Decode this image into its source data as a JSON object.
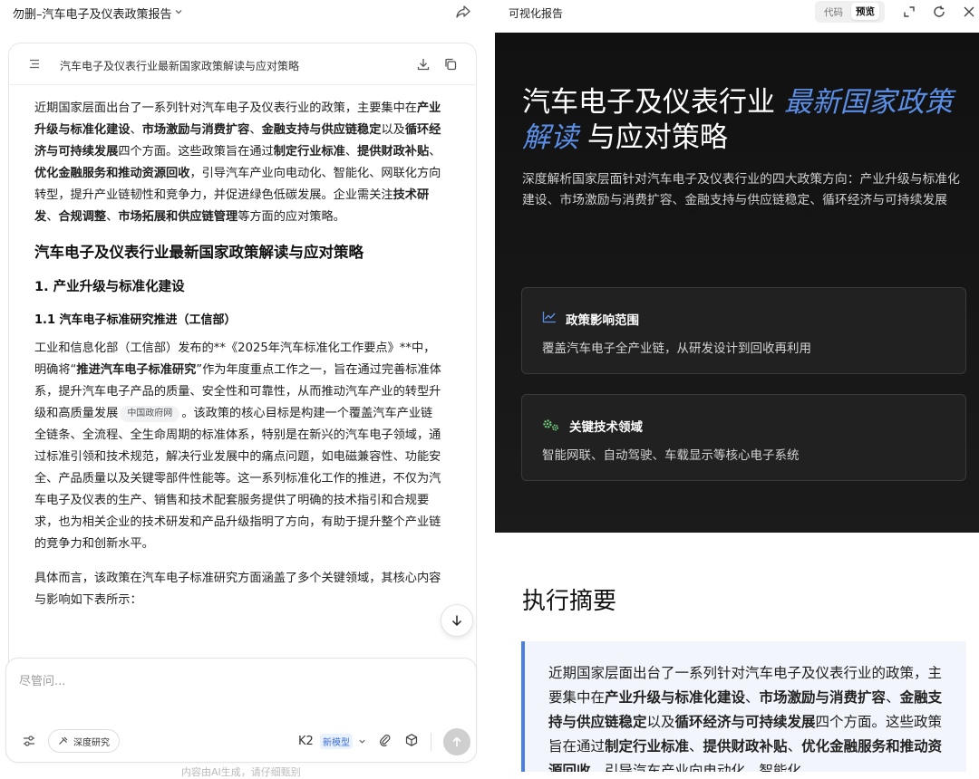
{
  "left": {
    "title": "勿删–汽车电子及仪表政策报告",
    "doc_card": {
      "title": "汽车电子及仪表行业最新国家政策解读与应对策略"
    },
    "doc": {
      "intro": [
        {
          "t": "近期国家层面出台了一系列针对汽车电子及仪表行业的政策，主要集中在",
          "b": false
        },
        {
          "t": "产业升级与标准化建设",
          "b": true
        },
        {
          "t": "、",
          "b": false
        },
        {
          "t": "市场激励与消费扩容",
          "b": true
        },
        {
          "t": "、",
          "b": false
        },
        {
          "t": "金融支持与供应链稳定",
          "b": true
        },
        {
          "t": "以及",
          "b": false
        },
        {
          "t": "循环经济与可持续发展",
          "b": true
        },
        {
          "t": "四个方面。这些政策旨在通过",
          "b": false
        },
        {
          "t": "制定行业标准",
          "b": true
        },
        {
          "t": "、",
          "b": false
        },
        {
          "t": "提供财政补贴",
          "b": true
        },
        {
          "t": "、",
          "b": false
        },
        {
          "t": "优化金融服务和推动资源回收",
          "b": true
        },
        {
          "t": "，引导汽车产业向电动化、智能化、网联化方向转型，提升产业链韧性和竞争力，并促进绿色低碳发展。企业需关注",
          "b": false
        },
        {
          "t": "技术研发",
          "b": true
        },
        {
          "t": "、",
          "b": false
        },
        {
          "t": "合规调整",
          "b": true
        },
        {
          "t": "、",
          "b": false
        },
        {
          "t": "市场拓展和供应链管理",
          "b": true
        },
        {
          "t": "等方面的应对策略。",
          "b": false
        }
      ],
      "h2": "汽车电子及仪表行业最新国家政策解读与应对策略",
      "h3": "1. 产业升级与标准化建设",
      "h4": "1.1 汽车电子标准研究推进（工信部）",
      "para2_a": "工业和信息化部（工信部）发布的**《2025年汽车标准化工作要点》**中，明确将“",
      "para2_bold": "推进汽车电子标准研究",
      "para2_b": "”作为年度重点工作之一，旨在通过完善标准体系，提升汽车电子产品的质量、安全性和可靠性，从而推动汽车产业的转型升级和高质量发展",
      "citation": "中国政府网",
      "para2_c": "。该政策的核心目标是构建一个覆盖汽车产业链全链条、全流程、全生命周期的标准体系，特别是在新兴的汽车电子领域，通过标准引领和技术规范，解决行业发展中的痛点问题，如电磁兼容性、功能安全、产品质量以及关键零部件性能等。这一系列标准化工作的推进，不仅为汽车电子及仪表的生产、销售和技术配套服务提供了明确的技术指引和合规要求，也为相关企业的技术研发和产品升级指明了方向，有助于提升整个产业链的竞争力和创新水平。",
      "para3": "具体而言，该政策在汽车电子标准研究方面涵盖了多个关键领域，其核心内容与影响如下表所示："
    },
    "composer": {
      "placeholder": "尽管问...",
      "deep_research": "深度研究",
      "model": "K2",
      "model_badge": "新模型"
    },
    "footer_note": "内容由AI生成，请仔细甄别"
  },
  "right": {
    "panel_title": "可视化报告",
    "tab_code": "代码",
    "tab_preview": "预览",
    "hero": {
      "title_a": "汽车电子及仪表行业 ",
      "title_accent": "最新国家政策解读",
      "title_b": " 与应对策略",
      "subtitle": "深度解析国家层面针对汽车电子及仪表行业的四大政策方向：产业升级与标准化建设、市场激励与消费扩容、金融支持与供应链稳定、循环经济与可持续发展"
    },
    "cards": {
      "scope_title": "政策影响范围",
      "scope_desc": "覆盖汽车电子全产业链，从研发设计到回收再利用",
      "tech_title": "关键技术领域",
      "tech_desc": "智能网联、自动驾驶、车载显示等核心电子系统"
    },
    "summary": {
      "heading": "执行摘要",
      "text": [
        {
          "t": "近期国家层面出台了一系列针对汽车电子及仪表行业的政策，主要集中在",
          "b": false
        },
        {
          "t": "产业升级与标准化建设",
          "b": true
        },
        {
          "t": "、",
          "b": false
        },
        {
          "t": "市场激励与消费扩容",
          "b": true
        },
        {
          "t": "、",
          "b": false
        },
        {
          "t": "金融支持与供应链稳定",
          "b": true
        },
        {
          "t": "以及",
          "b": false
        },
        {
          "t": "循环经济与可持续发展",
          "b": true
        },
        {
          "t": "四个方面。这些政策旨在通过",
          "b": false
        },
        {
          "t": "制定行业标准",
          "b": true
        },
        {
          "t": "、",
          "b": false
        },
        {
          "t": "提供财政补贴",
          "b": true
        },
        {
          "t": "、",
          "b": false
        },
        {
          "t": "优化金融服务和推动资源回收",
          "b": true
        },
        {
          "t": "，引导汽车产业向电动化、智能化",
          "b": false
        }
      ]
    }
  },
  "colors": {
    "accent": "#5b8ee6",
    "summary_border": "#4d7fe0",
    "badge": "#3b6ed6"
  },
  "icons": [
    "chevron-down-icon",
    "share-icon",
    "toc-icon",
    "download-icon",
    "copy-icon",
    "arrow-down-icon",
    "settings-icon",
    "telescope-icon",
    "paperclip-icon",
    "cube-icon",
    "send-arrow-icon",
    "expand-icon",
    "refresh-icon",
    "close-icon",
    "chart-line-icon",
    "gears-icon"
  ]
}
